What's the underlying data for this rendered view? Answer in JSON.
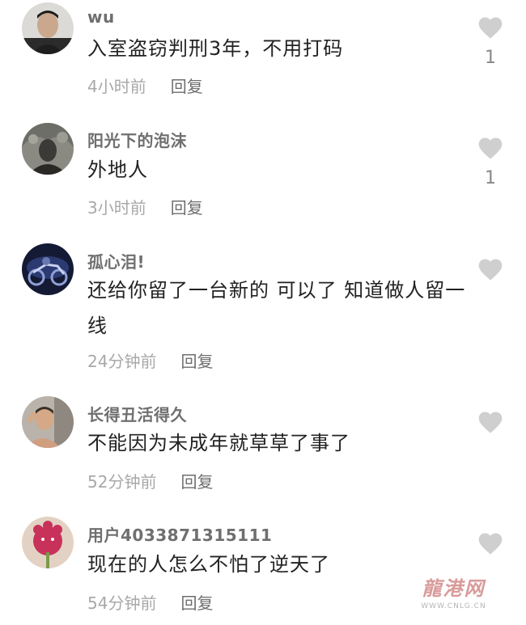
{
  "comments": [
    {
      "username": "wu",
      "text": "入室盗窃判刑3年，不用打码",
      "time": "4小时前",
      "reply": "回复",
      "likes": "1"
    },
    {
      "username": "阳光下的泡沫",
      "text": "外地人",
      "time": "3小时前",
      "reply": "回复",
      "likes": "1"
    },
    {
      "username": "孤心泪!",
      "text": "还给你留了一台新的 可以了 知道做人留一线",
      "time": "24分钟前",
      "reply": "回复",
      "likes": ""
    },
    {
      "username": "长得丑活得久",
      "text": "不能因为未成年就草草了事了",
      "time": "52分钟前",
      "reply": "回复",
      "likes": ""
    },
    {
      "username": "用户4033871315111",
      "text": "现在的人怎么不怕了逆天了",
      "time": "54分钟前",
      "reply": "回复",
      "likes": ""
    }
  ],
  "watermark": {
    "logo": "龍港网",
    "url": "WWW.CNLG.CN"
  },
  "colors": {
    "heart": "#cfcfcf",
    "username": "#6f6f6f",
    "meta": "#a8a8a8",
    "text": "#222222"
  },
  "icons": {
    "like": "heart-icon"
  }
}
